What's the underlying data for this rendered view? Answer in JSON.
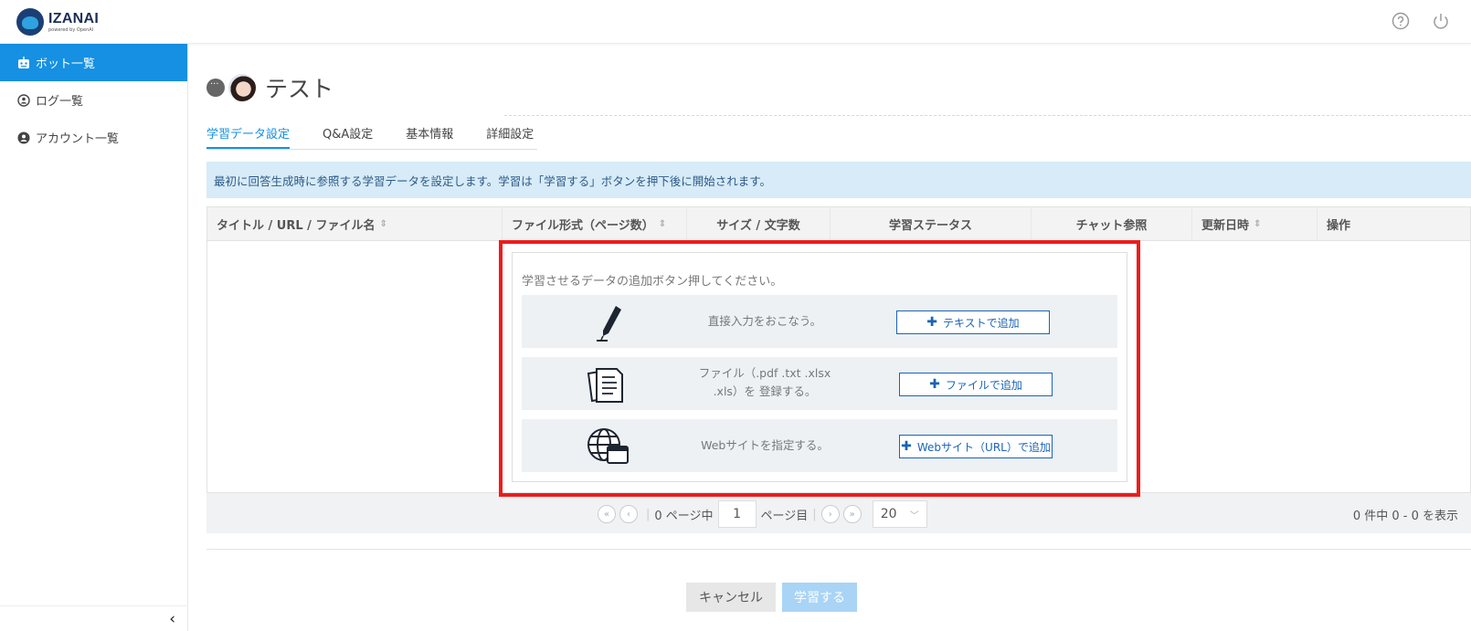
{
  "app": {
    "name": "IZANAI",
    "tagline": "powered by OpenAI"
  },
  "header": {
    "help_icon": "help-circle-icon",
    "power_icon": "power-icon"
  },
  "sidebar": {
    "items": [
      {
        "label": "ボット一覧",
        "icon": "bot-icon",
        "active": true
      },
      {
        "label": "ログ一覧",
        "icon": "log-icon",
        "active": false
      },
      {
        "label": "アカウント一覧",
        "icon": "account-icon",
        "active": false
      }
    ],
    "collapse_glyph": "‹"
  },
  "page": {
    "title": "テスト"
  },
  "tabs": [
    {
      "label": "学習データ設定",
      "active": true
    },
    {
      "label": "Q&A設定",
      "active": false
    },
    {
      "label": "基本情報",
      "active": false
    },
    {
      "label": "詳細設定",
      "active": false
    }
  ],
  "notice": "最初に回答生成時に参照する学習データを設定します。学習は「学習する」ボタンを押下後に開始されます。",
  "table": {
    "columns": [
      {
        "label": "タイトル / URL / ファイル名",
        "sortable": true
      },
      {
        "label": "ファイル形式（ページ数）",
        "sortable": true
      },
      {
        "label": "サイズ / 文字数",
        "sortable": false
      },
      {
        "label": "学習ステータス",
        "sortable": false
      },
      {
        "label": "チャット参照",
        "sortable": false
      },
      {
        "label": "更新日時",
        "sortable": true
      },
      {
        "label": "操作",
        "sortable": false
      }
    ],
    "sort_glyph": "⇕"
  },
  "empty_state": {
    "hint": "学習させるデータの追加ボタン押してください。",
    "options": [
      {
        "text": "直接入力をおこなう。",
        "button": "テキストで追加",
        "icon": "pen-icon"
      },
      {
        "text_line1": "ファイル（.pdf .txt .xlsx",
        "text_line2": ".xls）を 登録する。",
        "button": "ファイルで追加",
        "icon": "documents-icon"
      },
      {
        "text": "Webサイトを指定する。",
        "button": "Webサイト（URL）で追加",
        "icon": "globe-window-icon"
      }
    ],
    "plus": "✚"
  },
  "pager": {
    "first": "«",
    "prev": "‹",
    "next": "›",
    "last": "»",
    "of_pages": "0 ページ中",
    "current_page": "1",
    "page_suffix": "ページ目",
    "page_size": "20",
    "summary": "0 件中 0 - 0 を表示"
  },
  "actions": {
    "cancel": "キャンセル",
    "learn": "学習する"
  },
  "colors": {
    "accent": "#1690e3",
    "notice_bg": "#d7ebf8",
    "highlight": "#ee1c1c",
    "button_border": "#1a63b8",
    "learn_disabled": "#a9d4f5"
  }
}
